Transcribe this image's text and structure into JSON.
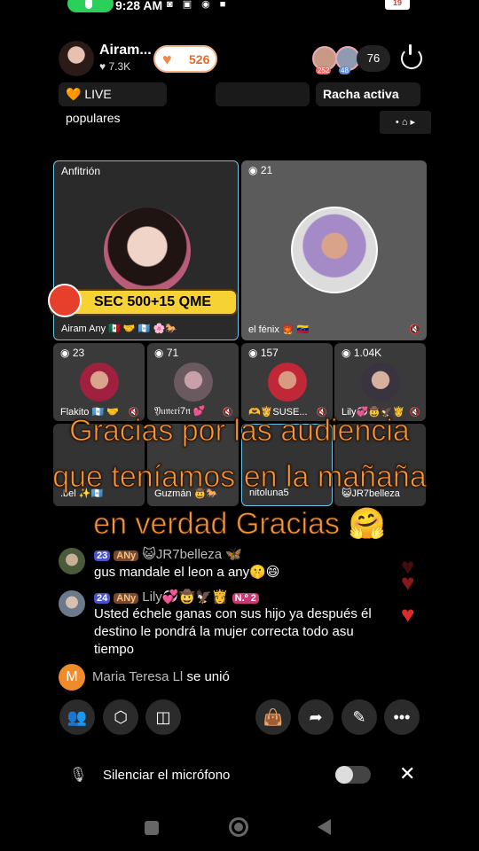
{
  "status_bar": {
    "time": "9:28 AM",
    "battery": "19"
  },
  "host": {
    "name": "Airam...",
    "likes": "♥ 7.3K",
    "fan_count": "526"
  },
  "viewers": {
    "badge1": "252",
    "badge2": "48",
    "count": "76"
  },
  "tags": {
    "live": "🧡 LIVE populares",
    "racha": "Racha activa"
  },
  "grid": {
    "host_tile": {
      "title": "Anfitrión",
      "label": "Airam Any 🇲🇽 🤝 🇬🇹 🌸🐎",
      "banner": "SEC 500+15  QME"
    },
    "fenix_tile": {
      "viewers": "21",
      "label": "el fénix 🐦‍🔥 🇻🇪"
    },
    "small_tiles": [
      {
        "viewers": "23",
        "label": "Flakito 🇬🇹 🤝"
      },
      {
        "viewers": "71",
        "label": "𝔜𝔲𝔫𝔢𝔯𝔦7𝔫 💕"
      },
      {
        "viewers": "157",
        "label": "🫶👸SUSE..."
      },
      {
        "viewers": "1.04K",
        "label": "Lily💞🤠🦅👸"
      }
    ],
    "row2_tiles": [
      {
        "label": ".bel ✨🇬🇹"
      },
      {
        "label": "Guzmán 🤠🐎"
      },
      {
        "label": "nitoluna5"
      },
      {
        "label": "😺JR7belleza"
      }
    ]
  },
  "caption": {
    "line1": "Gracias por las audiencia",
    "line2": "que teníamos en la mañaña",
    "line3": "en verdad Gracias 🤗"
  },
  "chat": [
    {
      "level": "23",
      "fan": "ANy",
      "user": "😺JR7belleza 🦋",
      "message": "gus mandale el leon a any🤫😄"
    },
    {
      "level": "24",
      "fan": "ANy",
      "user": "Lily💞🤠🦅👸",
      "extra": "N.º 2",
      "message1": "Usted échele ganas con sus hijo ya después él",
      "message2": "destino le pondrá la mujer correcta todo asu",
      "message3": "tiempo"
    }
  ],
  "join": {
    "initial": "M",
    "user": "Maria Teresa Ll",
    "action": "se unió"
  },
  "mic_bar": {
    "text": "Silenciar el micrófono"
  },
  "icons": [
    "guests-icon",
    "box-icon",
    "add-effects-icon",
    "gift-bag-icon",
    "share-icon",
    "magic-wand-icon",
    "more-icon"
  ]
}
